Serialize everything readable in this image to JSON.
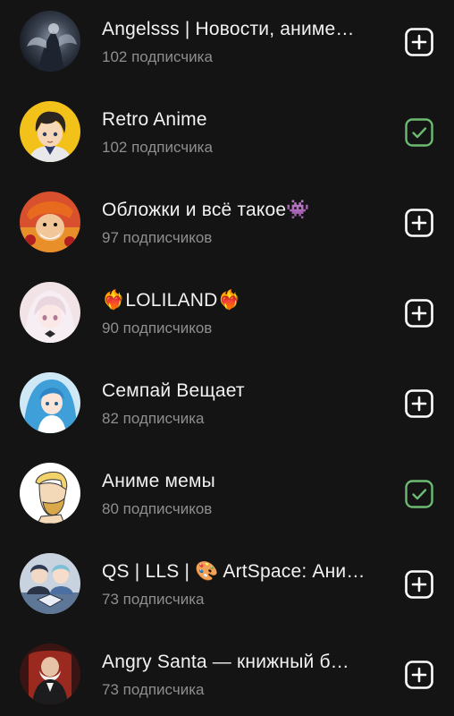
{
  "channels": [
    {
      "title": "Angelsss | Новости, аниме…",
      "subscribers": "102 подписчика",
      "subscribed": false,
      "avatar_icon": "dark-angel-art"
    },
    {
      "title": "Retro Anime",
      "subscribers": "102 подписчика",
      "subscribed": true,
      "avatar_icon": "anime-boy-yellow"
    },
    {
      "title": "Обложки и всё такое👾",
      "subscribers": "97 подписчиков",
      "subscribed": false,
      "avatar_icon": "pirate-anime-character"
    },
    {
      "title": "❤️‍🔥LOLILAND❤️‍🔥",
      "subscribers": "90 подписчиков",
      "subscribed": false,
      "avatar_icon": "pastel-anime-girl"
    },
    {
      "title": "Семпай Вещает",
      "subscribers": "82 подписчика",
      "subscribed": false,
      "avatar_icon": "blue-hair-anime-girl"
    },
    {
      "title": "Аниме мемы",
      "subscribers": "80 подписчиков",
      "subscribed": true,
      "avatar_icon": "chad-meme-face"
    },
    {
      "title": "QS | LLS | 🎨 ArtSpace: Ани…",
      "subscribers": "73 подписчика",
      "subscribed": false,
      "avatar_icon": "anime-duo-logo"
    },
    {
      "title": "Angry Santa — книжный б…",
      "subscribers": "73 подписчика",
      "subscribed": false,
      "avatar_icon": "old-man-red-chair"
    }
  ],
  "colors": {
    "background": "#141414",
    "add_icon": "#ffffff",
    "subscribed_icon": "#6dbb72",
    "subtitle": "#8e8e8e"
  }
}
